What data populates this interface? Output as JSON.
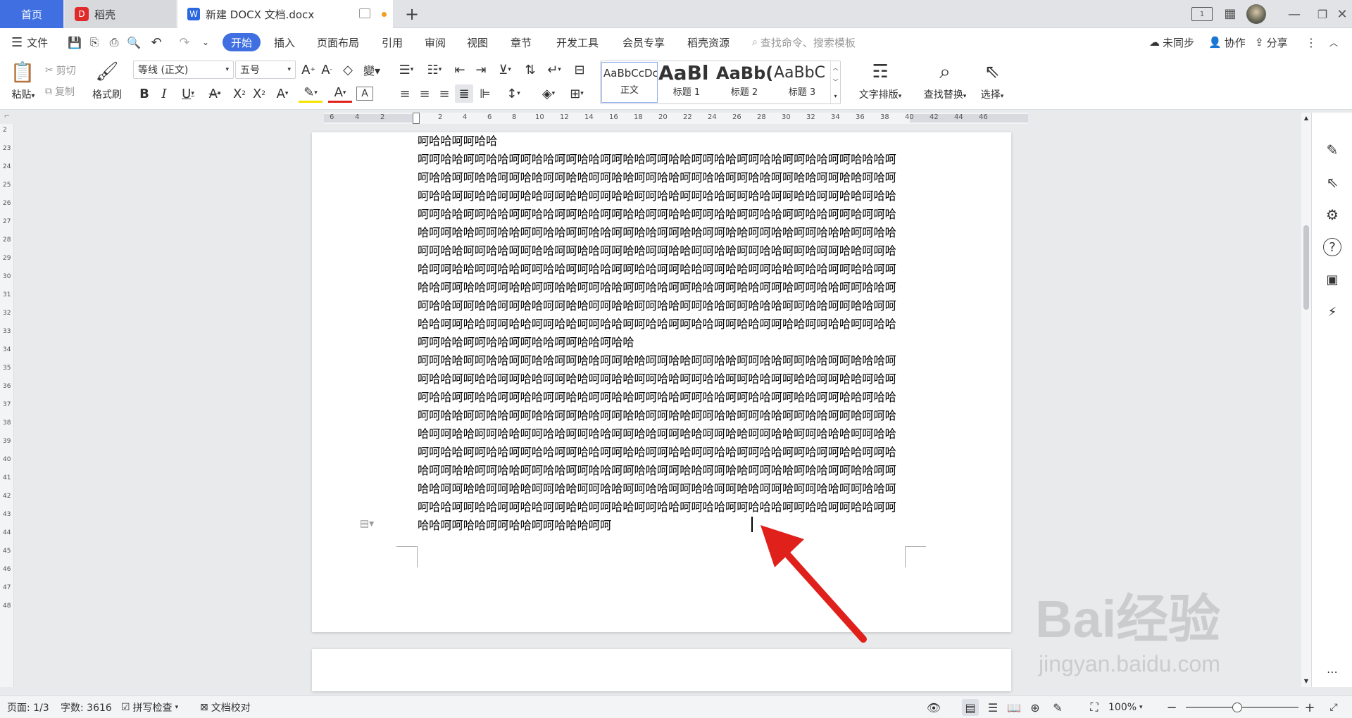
{
  "tabs": {
    "home": "首页",
    "daoke": "稻壳",
    "doc": "新建 DOCX 文档.docx",
    "new_tab": "+"
  },
  "menu": {
    "file": "文件",
    "start": "开始",
    "insert": "插入",
    "layout": "页面布局",
    "reference": "引用",
    "review": "审阅",
    "view": "视图",
    "chapter": "章节",
    "devtools": "开发工具",
    "member": "会员专享",
    "resource": "稻壳资源",
    "search_placeholder": "查找命令、搜索模板",
    "sync": "未同步",
    "collab": "协作",
    "share": "分享"
  },
  "ribbon": {
    "paste": "粘贴",
    "cut": "剪切",
    "copy": "复制",
    "format_painter": "格式刷",
    "font": "等线 (正文)",
    "size": "五号",
    "styles": [
      {
        "preview": "AaBbCcDc",
        "name": "正文"
      },
      {
        "preview": "AaBl",
        "name": "标题 1"
      },
      {
        "preview": "AaBb(",
        "name": "标题 2"
      },
      {
        "preview": "AaBbC",
        "name": "标题 3"
      }
    ],
    "text_layout": "文字排版",
    "find_replace": "查找替换",
    "select": "选择"
  },
  "ruler": {
    "h_left": [
      "6",
      "4",
      "2"
    ],
    "h_right": [
      "2",
      "4",
      "6",
      "8",
      "10",
      "12",
      "14",
      "16",
      "18",
      "20",
      "22",
      "24",
      "26",
      "28",
      "30",
      "32",
      "34",
      "36",
      "38",
      "40",
      "42",
      "44",
      "46"
    ],
    "v": [
      "2",
      "23",
      "24",
      "25",
      "26",
      "27",
      "28",
      "29",
      "30",
      "31",
      "32",
      "33",
      "34",
      "35",
      "36",
      "37",
      "38",
      "39",
      "40",
      "41",
      "42",
      "43",
      "44",
      "45",
      "46",
      "47",
      "48"
    ]
  },
  "document": {
    "para1": "呵哈哈呵呵哈哈",
    "para2": "呵呵哈哈呵呵哈哈呵呵哈哈呵呵哈哈呵呵哈哈呵呵哈哈呵呵哈哈呵呵哈哈呵呵哈哈呵呵哈哈哈呵呵哈哈呵呵哈哈呵呵哈哈呵呵哈哈呵呵哈哈呵呵哈哈呵呵哈哈呵呵哈哈呵呵哈哈呵呵哈哈呵哈呵呵哈哈呵呵哈哈呵呵哈哈呵呵哈哈呵呵哈哈呵呵哈哈呵呵哈哈呵呵哈哈呵呵哈哈呵呵哈哈呵哈哈呵呵哈哈呵呵哈哈呵呵哈哈呵呵哈哈呵呵哈哈呵呵哈哈呵呵哈哈呵呵哈哈呵呵哈哈呵呵哈呵呵哈哈呵呵哈哈呵呵哈哈呵呵哈哈呵呵哈哈呵呵哈哈呵呵哈哈呵呵哈哈呵呵哈哈呵呵哈哈哈呵呵哈哈呵呵哈哈呵呵哈哈呵呵哈哈呵呵哈哈呵呵哈哈呵呵哈哈呵呵哈哈呵呵哈哈呵呵哈呵呵哈哈呵呵哈哈呵呵哈哈呵呵哈哈呵呵哈哈呵呵哈哈呵呵哈哈呵呵哈哈呵呵哈哈呵呵哈哈呵哈哈呵呵哈哈呵呵哈哈呵呵哈哈呵呵哈哈呵呵哈哈呵呵哈哈呵呵哈哈呵呵哈哈呵呵哈哈呵呵哈呵呵哈哈呵呵哈哈呵呵哈哈呵呵哈哈呵呵哈哈呵呵哈哈呵呵哈哈呵呵哈哈呵呵哈哈呵呵哈哈哈呵呵哈哈呵呵哈哈呵呵哈哈呵呵哈哈呵呵哈哈呵呵哈哈呵呵哈哈呵呵哈哈呵呵哈哈呵呵哈哈呵呵哈哈呵呵哈哈呵呵哈哈呵呵哈哈呵呵哈哈呵呵哈哈呵呵哈哈呵哈哈",
    "para3": "呵呵哈哈呵呵哈哈呵呵哈哈呵呵哈哈呵呵哈哈呵呵哈哈呵呵哈哈呵呵哈哈呵呵哈哈呵呵哈哈哈呵呵哈哈呵呵哈哈呵呵哈哈呵呵哈哈呵呵哈哈呵呵哈哈呵呵哈哈呵呵哈哈呵呵哈哈呵呵哈哈呵哈呵呵哈哈呵呵哈哈呵呵哈哈呵呵哈哈呵呵哈哈呵呵哈哈呵呵哈哈呵呵哈哈呵呵哈哈呵呵哈哈呵哈哈呵呵哈哈呵呵哈哈呵呵哈哈呵呵哈哈呵呵哈哈呵呵哈哈呵呵哈哈呵呵哈哈呵呵哈哈呵呵哈呵呵哈哈呵呵哈哈呵呵哈哈呵呵哈哈呵呵哈哈呵呵哈哈呵呵哈哈呵呵哈哈呵呵哈哈呵呵哈哈哈呵呵哈哈呵呵哈哈呵呵哈哈呵呵哈哈呵呵哈哈呵呵哈哈呵呵哈哈呵呵哈哈呵呵哈哈呵呵哈呵呵哈哈呵呵哈哈呵呵哈哈呵呵哈哈呵呵哈哈呵呵哈哈呵呵哈哈呵呵哈哈呵呵哈哈呵呵哈哈呵哈哈呵呵哈哈呵呵哈哈呵呵哈哈呵呵哈哈呵呵哈哈呵呵哈哈呵呵哈哈呵呵哈哈呵呵哈哈呵呵哈呵呵哈哈呵呵哈哈呵呵哈哈呵呵哈哈呵呵哈哈呵呵哈哈呵呵哈哈呵呵哈哈呵呵哈哈呵呵哈哈哈呵呵哈哈呵呵哈哈呵呵哈哈呵呵哈哈呵呵哈哈呵呵哈哈哈呵呵"
  },
  "status": {
    "page": "页面: 1/3",
    "words": "字数: 3616",
    "spell": "拼写检查",
    "proof": "文档校对",
    "zoom": "100%"
  },
  "watermark": {
    "brand": "Bai经验",
    "url": "jingyan.baidu.com"
  },
  "colors": {
    "accent": "#3f6fe0",
    "arrow": "#e0211b"
  }
}
